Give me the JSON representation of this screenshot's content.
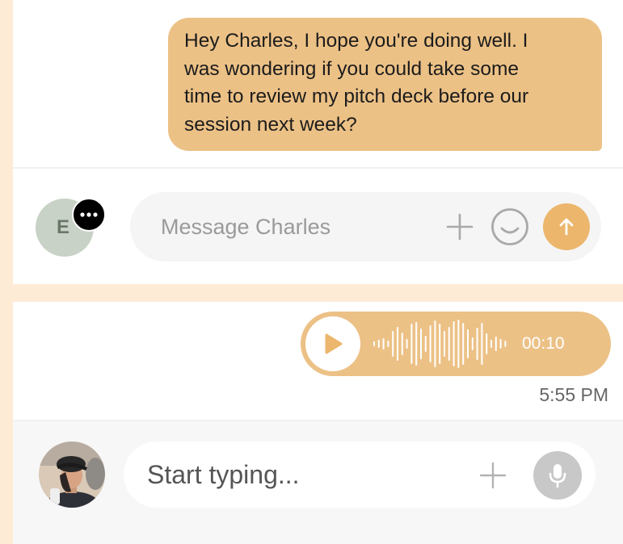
{
  "top_chat": {
    "message": {
      "lines": [
        "Hey Charles, I hope you're doing well. I",
        "was wondering if you could take some",
        "time to review my pitch deck before our",
        "session next week?"
      ]
    },
    "composer": {
      "avatar_initial": "E",
      "placeholder": "Message Charles",
      "icons": {
        "more": "more-options-icon",
        "add": "plus-icon",
        "emoji": "emoji-icon",
        "send": "arrow-up-icon"
      }
    }
  },
  "bottom_chat": {
    "voice_message": {
      "duration": "00:10",
      "icon": "play-icon"
    },
    "timestamp": "5:55 PM",
    "composer": {
      "placeholder": "Start typing...",
      "icons": {
        "add": "plus-icon",
        "mic": "microphone-icon"
      }
    }
  },
  "colors": {
    "page_background": "#fdebd6",
    "bubble": "#ecc186",
    "send_button": "#ecb66c",
    "avatar_background": "#c8d2c6",
    "mic_button": "#c8c8c8"
  }
}
